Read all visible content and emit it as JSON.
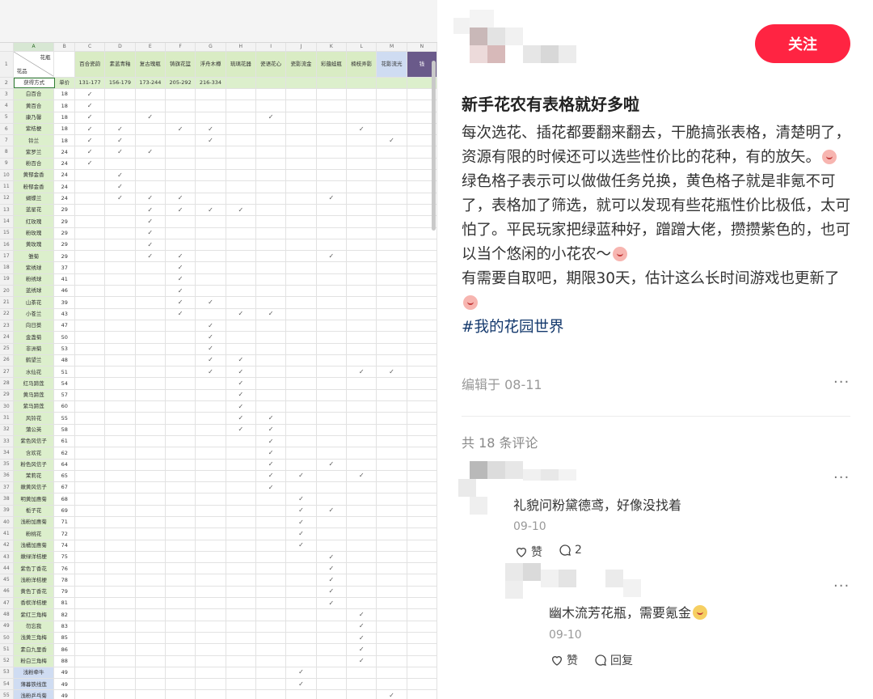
{
  "sheet": {
    "col_letters": [
      "A",
      "B",
      "C",
      "D",
      "E",
      "F",
      "G",
      "H",
      "I",
      "J",
      "K",
      "L",
      "M",
      "N"
    ],
    "corner_top": "花瓶",
    "corner_bottom": "花品",
    "vases": [
      "百合瓷韵",
      "素蓝青釉",
      "复古瑰瓶",
      "铸旗花篮",
      "浮舟木樽",
      "琉璃花器",
      "瓷语花心",
      "瓷影流金",
      "彩蕴蛙瓶",
      "楠枝弄影",
      "花影流光",
      "钱"
    ],
    "row2": {
      "label": "获得方式",
      "price": "单价",
      "ranges": [
        "131-177",
        "156-179",
        "173-244",
        "205-292",
        "216-334",
        "",
        "",
        "",
        "",
        "",
        "",
        ""
      ]
    },
    "check_glyph": "✓",
    "rows": [
      {
        "n": "3",
        "name": "白百合",
        "price": "18",
        "c": [
          1,
          0,
          0,
          0,
          0,
          0,
          0,
          0,
          0,
          0,
          0,
          0
        ]
      },
      {
        "n": "4",
        "name": "黄百合",
        "price": "18",
        "c": [
          1,
          0,
          0,
          0,
          0,
          0,
          0,
          0,
          0,
          0,
          0,
          0
        ]
      },
      {
        "n": "5",
        "name": "康乃馨",
        "price": "18",
        "c": [
          1,
          0,
          1,
          0,
          0,
          0,
          1,
          0,
          0,
          0,
          0,
          0
        ]
      },
      {
        "n": "6",
        "name": "紫桔梗",
        "price": "18",
        "c": [
          1,
          1,
          0,
          1,
          1,
          0,
          0,
          0,
          0,
          1,
          0,
          0
        ]
      },
      {
        "n": "7",
        "name": "铃兰",
        "price": "18",
        "c": [
          1,
          1,
          0,
          0,
          1,
          0,
          0,
          0,
          0,
          0,
          1,
          0
        ]
      },
      {
        "n": "8",
        "name": "紫罗兰",
        "price": "24",
        "c": [
          1,
          1,
          1,
          0,
          0,
          0,
          0,
          0,
          0,
          0,
          0,
          0
        ]
      },
      {
        "n": "9",
        "name": "粉百合",
        "price": "24",
        "c": [
          1,
          0,
          0,
          0,
          0,
          0,
          0,
          0,
          0,
          0,
          0,
          0
        ]
      },
      {
        "n": "10",
        "name": "黄郁金香",
        "price": "24",
        "c": [
          0,
          1,
          0,
          0,
          0,
          0,
          0,
          0,
          0,
          0,
          0,
          0
        ]
      },
      {
        "n": "11",
        "name": "粉郁金香",
        "price": "24",
        "c": [
          0,
          1,
          0,
          0,
          0,
          0,
          0,
          0,
          0,
          0,
          0,
          0
        ]
      },
      {
        "n": "12",
        "name": "蝴蝶兰",
        "price": "24",
        "c": [
          0,
          1,
          1,
          1,
          0,
          0,
          0,
          0,
          1,
          0,
          0,
          0
        ]
      },
      {
        "n": "13",
        "name": "蓝星花",
        "price": "29",
        "c": [
          0,
          0,
          1,
          1,
          1,
          1,
          0,
          0,
          0,
          0,
          0,
          0
        ]
      },
      {
        "n": "14",
        "name": "红玫瑰",
        "price": "29",
        "c": [
          0,
          0,
          1,
          0,
          0,
          0,
          0,
          0,
          0,
          0,
          0,
          0
        ]
      },
      {
        "n": "15",
        "name": "粉玫瑰",
        "price": "29",
        "c": [
          0,
          0,
          1,
          0,
          0,
          0,
          0,
          0,
          0,
          0,
          0,
          0
        ]
      },
      {
        "n": "16",
        "name": "黄玫瑰",
        "price": "29",
        "c": [
          0,
          0,
          1,
          0,
          0,
          0,
          0,
          0,
          0,
          0,
          0,
          0
        ]
      },
      {
        "n": "17",
        "name": "雏菊",
        "price": "29",
        "c": [
          0,
          0,
          1,
          1,
          0,
          0,
          0,
          0,
          1,
          0,
          0,
          0
        ]
      },
      {
        "n": "18",
        "name": "紫绣球",
        "price": "37",
        "c": [
          0,
          0,
          0,
          1,
          0,
          0,
          0,
          0,
          0,
          0,
          0,
          0
        ]
      },
      {
        "n": "19",
        "name": "粉绣球",
        "price": "41",
        "c": [
          0,
          0,
          0,
          1,
          0,
          0,
          0,
          0,
          0,
          0,
          0,
          0
        ]
      },
      {
        "n": "20",
        "name": "蓝绣球",
        "price": "46",
        "c": [
          0,
          0,
          0,
          1,
          0,
          0,
          0,
          0,
          0,
          0,
          0,
          0
        ]
      },
      {
        "n": "21",
        "name": "山茶花",
        "price": "39",
        "c": [
          0,
          0,
          0,
          1,
          1,
          0,
          0,
          0,
          0,
          0,
          0,
          0
        ]
      },
      {
        "n": "22",
        "name": "小苍兰",
        "price": "43",
        "c": [
          0,
          0,
          0,
          1,
          0,
          1,
          1,
          0,
          0,
          0,
          0,
          0
        ]
      },
      {
        "n": "23",
        "name": "向日葵",
        "price": "47",
        "c": [
          0,
          0,
          0,
          0,
          1,
          0,
          0,
          0,
          0,
          0,
          0,
          0
        ]
      },
      {
        "n": "24",
        "name": "金盏菊",
        "price": "50",
        "c": [
          0,
          0,
          0,
          0,
          1,
          0,
          0,
          0,
          0,
          0,
          0,
          0
        ]
      },
      {
        "n": "25",
        "name": "非洲菊",
        "price": "53",
        "c": [
          0,
          0,
          0,
          0,
          1,
          0,
          0,
          0,
          0,
          0,
          0,
          0
        ]
      },
      {
        "n": "26",
        "name": "鹤望兰",
        "price": "48",
        "c": [
          0,
          0,
          0,
          0,
          1,
          1,
          0,
          0,
          0,
          0,
          0,
          0
        ]
      },
      {
        "n": "27",
        "name": "水仙花",
        "price": "51",
        "c": [
          0,
          0,
          0,
          0,
          1,
          1,
          0,
          0,
          0,
          1,
          1,
          0
        ]
      },
      {
        "n": "28",
        "name": "红马蹄莲",
        "price": "54",
        "c": [
          0,
          0,
          0,
          0,
          0,
          1,
          0,
          0,
          0,
          0,
          0,
          0
        ]
      },
      {
        "n": "29",
        "name": "黄马蹄莲",
        "price": "57",
        "c": [
          0,
          0,
          0,
          0,
          0,
          1,
          0,
          0,
          0,
          0,
          0,
          0
        ]
      },
      {
        "n": "30",
        "name": "紫马蹄莲",
        "price": "60",
        "c": [
          0,
          0,
          0,
          0,
          0,
          1,
          0,
          0,
          0,
          0,
          0,
          0
        ]
      },
      {
        "n": "31",
        "name": "风铃花",
        "price": "55",
        "c": [
          0,
          0,
          0,
          0,
          0,
          1,
          1,
          0,
          0,
          0,
          0,
          0
        ]
      },
      {
        "n": "32",
        "name": "蒲公英",
        "price": "58",
        "c": [
          0,
          0,
          0,
          0,
          0,
          1,
          1,
          0,
          0,
          0,
          0,
          0
        ]
      },
      {
        "n": "33",
        "name": "紫色风信子",
        "price": "61",
        "c": [
          0,
          0,
          0,
          0,
          0,
          0,
          1,
          0,
          0,
          0,
          0,
          0
        ]
      },
      {
        "n": "34",
        "name": "含欢花",
        "price": "62",
        "c": [
          0,
          0,
          0,
          0,
          0,
          0,
          1,
          0,
          0,
          0,
          0,
          0
        ]
      },
      {
        "n": "35",
        "name": "粉色风信子",
        "price": "64",
        "c": [
          0,
          0,
          0,
          0,
          0,
          0,
          1,
          0,
          1,
          0,
          0,
          0
        ]
      },
      {
        "n": "36",
        "name": "茉莉花",
        "price": "65",
        "c": [
          0,
          0,
          0,
          0,
          0,
          0,
          1,
          1,
          0,
          1,
          0,
          0
        ]
      },
      {
        "n": "37",
        "name": "嫩黄风信子",
        "price": "67",
        "c": [
          0,
          0,
          0,
          0,
          0,
          0,
          1,
          0,
          0,
          0,
          0,
          0
        ]
      },
      {
        "n": "38",
        "name": "明黄加惠菊",
        "price": "68",
        "c": [
          0,
          0,
          0,
          0,
          0,
          0,
          0,
          1,
          0,
          0,
          0,
          0
        ]
      },
      {
        "n": "39",
        "name": "栀子花",
        "price": "69",
        "c": [
          0,
          0,
          0,
          0,
          0,
          0,
          0,
          1,
          1,
          0,
          0,
          0
        ]
      },
      {
        "n": "40",
        "name": "浅粉加惠菊",
        "price": "71",
        "c": [
          0,
          0,
          0,
          0,
          0,
          0,
          0,
          1,
          0,
          0,
          0,
          0
        ]
      },
      {
        "n": "41",
        "name": "粉桃花",
        "price": "72",
        "c": [
          0,
          0,
          0,
          0,
          0,
          0,
          0,
          1,
          0,
          0,
          0,
          0
        ]
      },
      {
        "n": "42",
        "name": "浅橘加惠菊",
        "price": "74",
        "c": [
          0,
          0,
          0,
          0,
          0,
          0,
          0,
          1,
          0,
          0,
          0,
          0
        ]
      },
      {
        "n": "43",
        "name": "嫩绿洋桔梗",
        "price": "75",
        "c": [
          0,
          0,
          0,
          0,
          0,
          0,
          0,
          0,
          1,
          0,
          0,
          0
        ]
      },
      {
        "n": "44",
        "name": "紫色丁香花",
        "price": "76",
        "c": [
          0,
          0,
          0,
          0,
          0,
          0,
          0,
          0,
          1,
          0,
          0,
          0
        ]
      },
      {
        "n": "45",
        "name": "浅粉洋桔梗",
        "price": "78",
        "c": [
          0,
          0,
          0,
          0,
          0,
          0,
          0,
          0,
          1,
          0,
          0,
          0
        ]
      },
      {
        "n": "46",
        "name": "黄色丁香花",
        "price": "79",
        "c": [
          0,
          0,
          0,
          0,
          0,
          0,
          0,
          0,
          1,
          0,
          0,
          0
        ]
      },
      {
        "n": "47",
        "name": "香槟洋桔梗",
        "price": "81",
        "c": [
          0,
          0,
          0,
          0,
          0,
          0,
          0,
          0,
          1,
          0,
          0,
          0
        ]
      },
      {
        "n": "48",
        "name": "紫红三角梅",
        "price": "82",
        "c": [
          0,
          0,
          0,
          0,
          0,
          0,
          0,
          0,
          0,
          1,
          0,
          0
        ]
      },
      {
        "n": "49",
        "name": "勿忘我",
        "price": "83",
        "c": [
          0,
          0,
          0,
          0,
          0,
          0,
          0,
          0,
          0,
          1,
          0,
          0
        ]
      },
      {
        "n": "50",
        "name": "浅黄三角梅",
        "price": "85",
        "c": [
          0,
          0,
          0,
          0,
          0,
          0,
          0,
          0,
          0,
          1,
          0,
          0
        ]
      },
      {
        "n": "51",
        "name": "素白九里香",
        "price": "86",
        "c": [
          0,
          0,
          0,
          0,
          0,
          0,
          0,
          0,
          0,
          1,
          0,
          0
        ]
      },
      {
        "n": "52",
        "name": "粉白三角梅",
        "price": "88",
        "c": [
          0,
          0,
          0,
          0,
          0,
          0,
          0,
          0,
          0,
          1,
          0,
          0
        ]
      },
      {
        "n": "53",
        "name": "浅粉牵牛",
        "price": "49",
        "c": [
          0,
          0,
          0,
          0,
          0,
          0,
          0,
          1,
          0,
          0,
          0,
          0
        ],
        "blue": true
      },
      {
        "n": "54",
        "name": "薄暮铁线莲",
        "price": "49",
        "c": [
          0,
          0,
          0,
          0,
          0,
          0,
          0,
          1,
          0,
          0,
          0,
          0
        ],
        "blue": true
      },
      {
        "n": "55",
        "name": "浅粉乒乓菊",
        "price": "49",
        "c": [
          0,
          0,
          0,
          0,
          0,
          0,
          0,
          0,
          0,
          0,
          1,
          0
        ],
        "blue": true
      }
    ]
  },
  "post": {
    "follow_label": "关注",
    "title": "新手花农有表格就好多啦",
    "paragraphs": [
      "每次选花、插花都要翻来翻去，干脆搞张表格，清楚明了，资源有限的时候还可以选些性价比的花种，有的放矢。",
      "绿色格子表示可以做做任务兑换，黄色格子就是非氪不可了，表格加了筛选，就可以发现有些花瓶性价比极低，太可怕了。平民玩家把绿蓝种好，蹭蹭大佬，攒攒紫色的，也可以当个悠闲的小花农～",
      "有需要自取吧，期限30天，估计这么长时间游戏也更新了"
    ],
    "hashtag": "#我的花园世界",
    "edited": "编辑于 08-11",
    "more_glyph": "···",
    "comment_count": "共 18 条评论",
    "comments": [
      {
        "text": "礼貌问粉黛德鸢，好像没找着",
        "date": "09-10",
        "like_label": "赞",
        "reply_count": "2"
      },
      {
        "text": "幽木流芳花瓶，需要氪金",
        "date": "09-10",
        "like_label": "赞",
        "reply_label": "回复"
      }
    ]
  },
  "colors": {
    "accent": "#ff2442",
    "hashtag": "#13386c",
    "green_cell": "#dcefcc",
    "blue_cell": "#cfdcf2"
  }
}
